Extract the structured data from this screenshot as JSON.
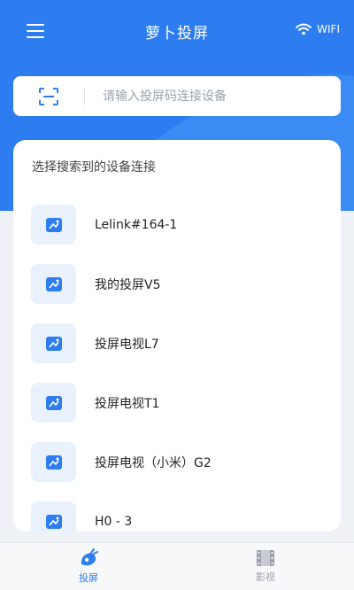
{
  "app": {
    "title": "萝卜投屏",
    "network_label": "WIFI"
  },
  "search": {
    "placeholder": "请输入投屏码连接设备",
    "value": ""
  },
  "devices_card": {
    "title": "选择搜索到的设备连接",
    "devices": [
      {
        "name": "Lelink#164-1"
      },
      {
        "name": "我的投屏V5"
      },
      {
        "name": "投屏电视L7"
      },
      {
        "name": "投屏电视T1"
      },
      {
        "name": "投屏电视（小米）G2"
      },
      {
        "name": "H0 - 3"
      }
    ]
  },
  "nav": {
    "tabs": [
      {
        "label": "投屏",
        "icon": "cast-icon",
        "active": true
      },
      {
        "label": "影视",
        "icon": "film-icon",
        "active": false
      }
    ]
  },
  "colors": {
    "accent": "#2d7df0",
    "background": "#eef1f5",
    "card": "#ffffff",
    "icon_bg": "#e9f1fd"
  }
}
